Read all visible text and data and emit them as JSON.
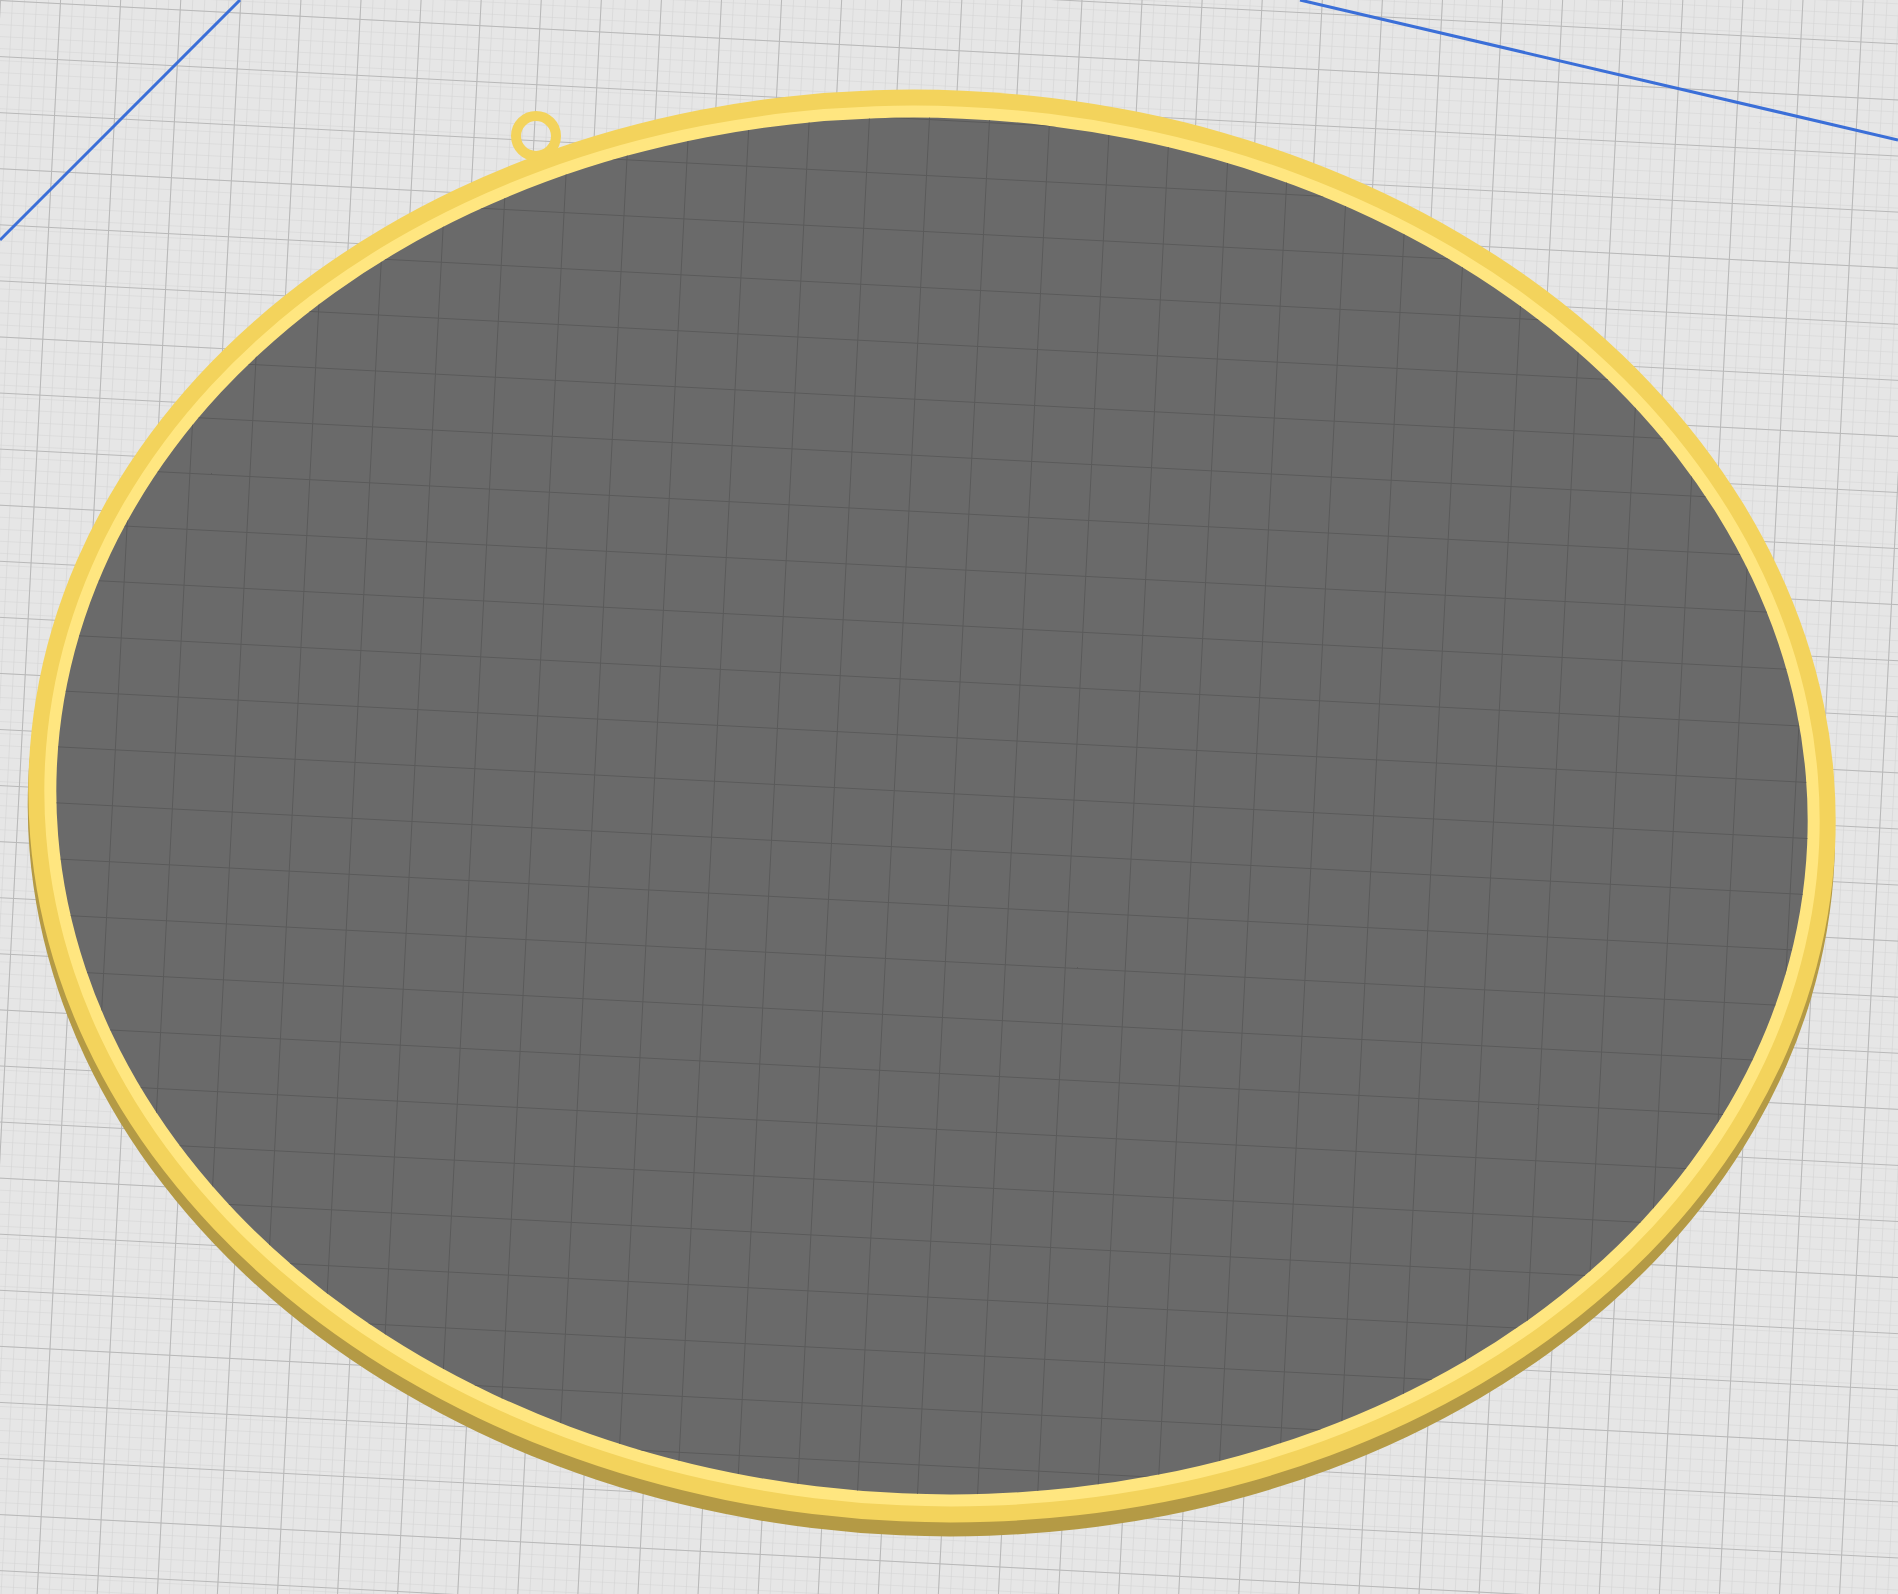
{
  "viewport": {
    "kind": "build-plate",
    "model": {
      "kind": "ring"
    }
  }
}
